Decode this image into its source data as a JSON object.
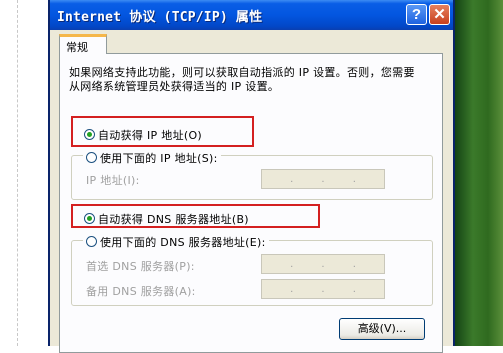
{
  "window": {
    "title": "Internet 协议 (TCP/IP) 属性",
    "help_label": "?",
    "close_label": "✕"
  },
  "tabs": [
    {
      "label": "常规"
    }
  ],
  "description": "如果网络支持此功能，则可以获取自动指派的 IP 设置。否则，您需要从网络系统管理员处获得适当的 IP 设置。",
  "ip": {
    "auto_label": "自动获得 IP 地址(O)",
    "manual_label": "使用下面的 IP 地址(S):",
    "address_label": "IP 地址(I):",
    "auto_selected": true
  },
  "dns": {
    "auto_label": "自动获得 DNS 服务器地址(B)",
    "manual_label": "使用下面的 DNS 服务器地址(E):",
    "preferred_label": "首选 DNS 服务器(P):",
    "alternate_label": "备用 DNS 服务器(A):",
    "auto_selected": true
  },
  "ip_placeholder_dots": [
    ".",
    ".",
    "."
  ],
  "buttons": {
    "advanced_label": "高级(V)..."
  },
  "colors": {
    "highlight_box": "#d42020",
    "titlebar": "#0356e0",
    "tab_accent": "#f5b74a"
  },
  "icons": {
    "help": "question-mark",
    "close": "x-close"
  }
}
